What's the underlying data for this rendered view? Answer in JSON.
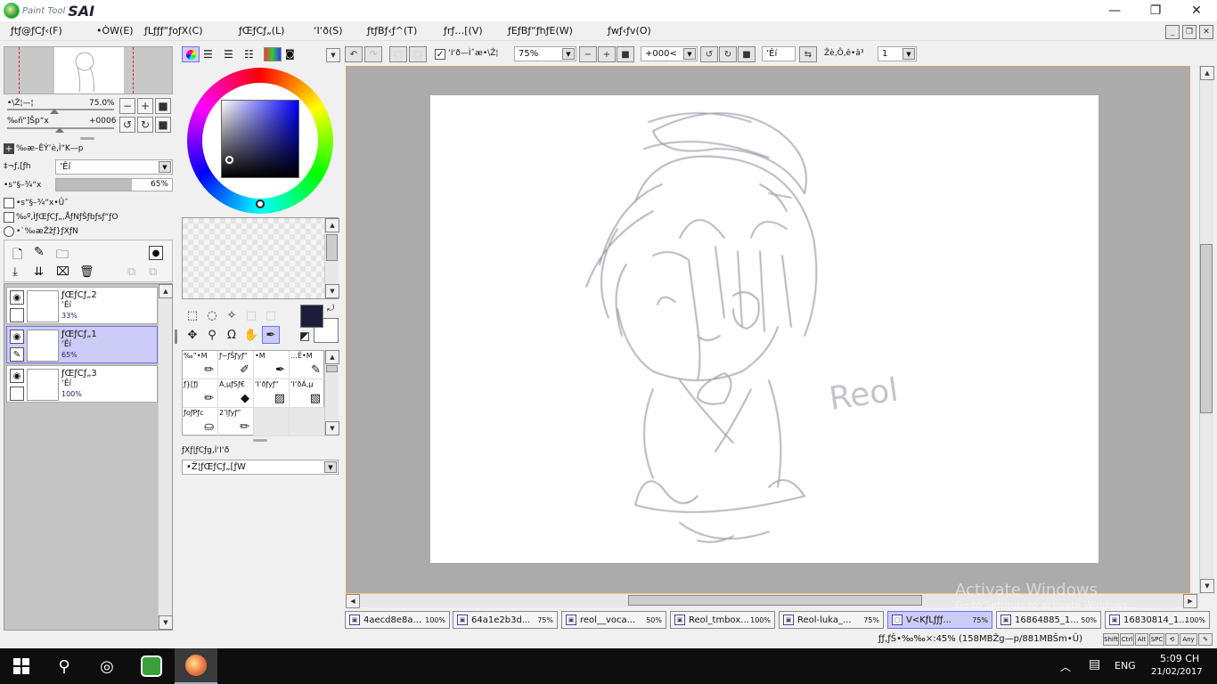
{
  "app": {
    "logo_small": "Paint Tool",
    "logo_big": "SAI"
  },
  "window_controls": {
    "minimize": "—",
    "restore": "❐",
    "close": "✕"
  },
  "menu": [
    {
      "label": "ƒtƒ@ƒCƒ‹(F)"
    },
    {
      "label": "•ÒW(E)"
    },
    {
      "label": "ƒLƒƒƒ“ƒoƒX(C)"
    },
    {
      "label": "ƒŒƒCƒ„(L)"
    },
    {
      "label": "‘I‘ð(S)"
    },
    {
      "label": "ƒtƒBƒ‹ƒ^(T)"
    },
    {
      "label": "ƒrƒ…[(V)"
    },
    {
      "label": "ƒEƒBƒ“ƒhƒE(W)"
    },
    {
      "label": "ƒwƒ‹ƒv(O)"
    }
  ],
  "navigator": {
    "zoom_label": "•\\Ž¦—¦",
    "zoom_value": "75.0%",
    "angle_label": "‰ñ“]Šp“x",
    "angle_value": "+0006"
  },
  "layer_props": {
    "section_title": "‰æ–ÊÝ’è‚Ì“K—p",
    "mode_label": "‡¬ƒ‚[ƒh",
    "mode_value": "’Êí",
    "opacity_label": "•s“§–¾“x",
    "opacity_value": "65%",
    "opacity_fraction": 0.65,
    "check1": "•s“§–¾“x•Ûˆ",
    "check2": "‰º‚ÌƒŒƒCƒ„‚ÅƒNƒŠƒbƒsƒ“ƒO",
    "radio1": "•`‰æŽžƒ}ƒXƒN"
  },
  "layers": [
    {
      "name": "ƒŒƒCƒ„2",
      "mode": "’Êí",
      "opacity": "33%"
    },
    {
      "name": "ƒŒƒCƒ„1",
      "mode": "’Êí",
      "opacity": "65%"
    },
    {
      "name": "ƒŒƒCƒ„3",
      "mode": "’Êí",
      "opacity": "100%"
    }
  ],
  "brushes": [
    {
      "label": "‰”•M",
      "icon": "pencil-icon"
    },
    {
      "label": "ƒ~ƒŠƒyƒ“",
      "icon": "airbrush-icon"
    },
    {
      "label": "•M",
      "icon": "pen-icon"
    },
    {
      "label": "…Ê•M",
      "icon": "watercolor-icon"
    },
    {
      "label": "ƒ}[ƒJ",
      "icon": "marker-icon"
    },
    {
      "label": "Á‚µƒSƒ€",
      "icon": "eraser-icon"
    },
    {
      "label": "‘I‘ðƒyƒ“",
      "icon": "select-pen-icon"
    },
    {
      "label": "‘I‘ðÁ‚µ",
      "icon": "select-erase-icon"
    },
    {
      "label": "ƒoƒPƒc",
      "icon": "bucket-icon"
    },
    {
      "label": "2’lƒyƒ“",
      "icon": "binary-pen-icon"
    }
  ],
  "texture": {
    "label": "ƒXƒ|ƒCƒg‚Ì‘I‘ð",
    "value": "•Ž¦ƒŒƒCƒ„[ƒW"
  },
  "colors": {
    "fg": "#1e1e3c",
    "bg": "#ffffff",
    "accent_select": "#ccccf6"
  },
  "toolbar": {
    "stabilizer_check_label": "‘I‘ð—Ìˆæ•\\Ž¦",
    "zoom_value": "75%",
    "angle_value": "+000<",
    "mode_value": "’Êí",
    "stab_label": "Žè‚Ô‚ê•â³",
    "stab_value": "1"
  },
  "canvas": {
    "signature": "Reol"
  },
  "doc_tabs": [
    {
      "name": "4aecd8e8a...",
      "zoom": "100%"
    },
    {
      "name": "64a1e2b3d...",
      "zoom": "75%"
    },
    {
      "name": "reol__voca...",
      "zoom": "50%"
    },
    {
      "name": "Reol_tmbox...",
      "zoom": "100%"
    },
    {
      "name": "Reol-luka_...",
      "zoom": "75%"
    },
    {
      "name": "V<KƒLƒƒƒ...",
      "zoom": "75%",
      "active": true
    },
    {
      "name": "16864885_1...",
      "zoom": "50%"
    },
    {
      "name": "16830814_1...",
      "zoom": "100%"
    }
  ],
  "status": {
    "memory": "ƒƒ‚ƒŠ•‰‰×:45% (158MBŽg—p/881MBŠm•Û)",
    "keys": [
      "Shift",
      "Ctrl",
      "Alt",
      "SPC",
      "⟲",
      "Any",
      "✎"
    ]
  },
  "watermark": {
    "line1": "Activate Windows",
    "line2": "Go to Settings to activate Windows."
  },
  "taskbar": {
    "lang": "ENG",
    "time": "5:09 CH",
    "date": "21/02/2017"
  }
}
